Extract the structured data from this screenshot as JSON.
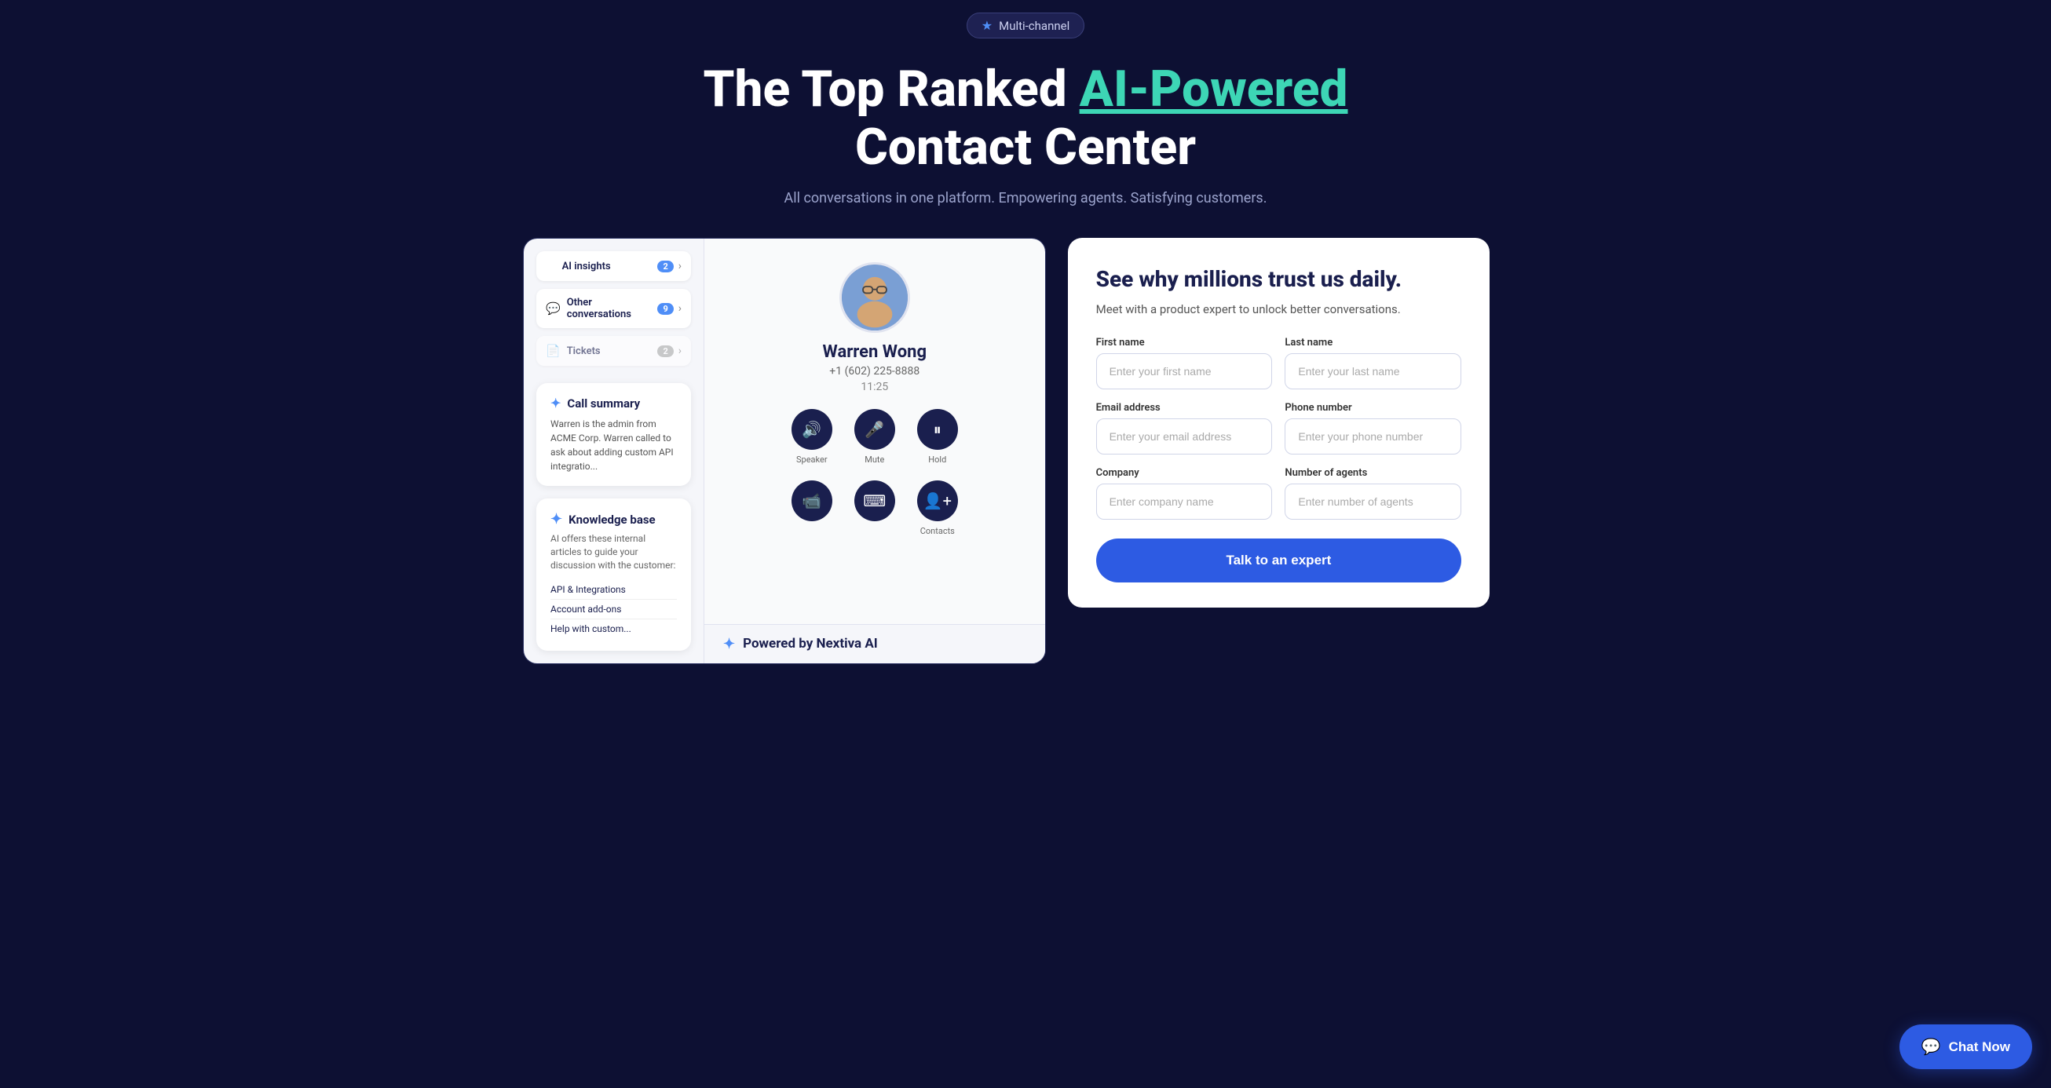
{
  "badge": {
    "icon": "★",
    "label": "Multi-channel"
  },
  "hero": {
    "title_part1": "The Top Ranked ",
    "title_accent": "AI-Powered",
    "title_part2": "Contact Center",
    "subtitle": "All conversations in one platform. Empowering agents. Satisfying customers."
  },
  "mockup": {
    "sidebar_items": [
      {
        "icon": "✦",
        "label": "AI insights",
        "badge": "2",
        "has_arrow": true
      },
      {
        "icon": "💬",
        "label": "Other conversations",
        "badge": "9",
        "has_arrow": true
      },
      {
        "icon": "📄",
        "label": "Tickets",
        "badge": "2",
        "has_arrow": true
      }
    ],
    "call_summary": {
      "title": "Call summary",
      "text": "Warren is the admin from ACME Corp. Warren called to ask about adding custom API integratio..."
    },
    "knowledge_base": {
      "title": "Knowledge base",
      "subtitle": "AI offers these internal articles to guide your discussion with the customer:",
      "links": [
        "API & Integrations",
        "Account add-ons",
        "Help with custom..."
      ]
    },
    "caller": {
      "name": "Warren Wong",
      "phone": "+1 (602) 225-8888",
      "time": "11:25"
    },
    "call_controls_row1": [
      {
        "icon": "🔊",
        "label": "Speaker"
      },
      {
        "icon": "🎤",
        "label": "Mute"
      },
      {
        "icon": "⏸",
        "label": "Hold"
      }
    ],
    "call_controls_row2": [
      {
        "icon": "📹",
        "label": ""
      },
      {
        "icon": "⌨",
        "label": ""
      },
      {
        "icon": "👤",
        "label": "Contacts"
      }
    ],
    "powered_by": "Powered by Nextiva AI"
  },
  "form": {
    "title": "See why millions trust us daily.",
    "subtitle": "Meet with a product expert to unlock better conversations.",
    "fields": [
      {
        "label": "First name",
        "placeholder": "Enter your first name",
        "id": "first_name"
      },
      {
        "label": "Last name",
        "placeholder": "Enter your last name",
        "id": "last_name"
      },
      {
        "label": "Email address",
        "placeholder": "Enter your email address",
        "id": "email"
      },
      {
        "label": "Phone number",
        "placeholder": "Enter your phone number",
        "id": "phone"
      },
      {
        "label": "Company",
        "placeholder": "Enter company name",
        "id": "company"
      },
      {
        "label": "Number of agents",
        "placeholder": "Enter number of agents",
        "id": "agents"
      }
    ],
    "submit_label": "Talk to an expert"
  },
  "chat_button": {
    "label": "Chat Now",
    "icon": "💬"
  }
}
